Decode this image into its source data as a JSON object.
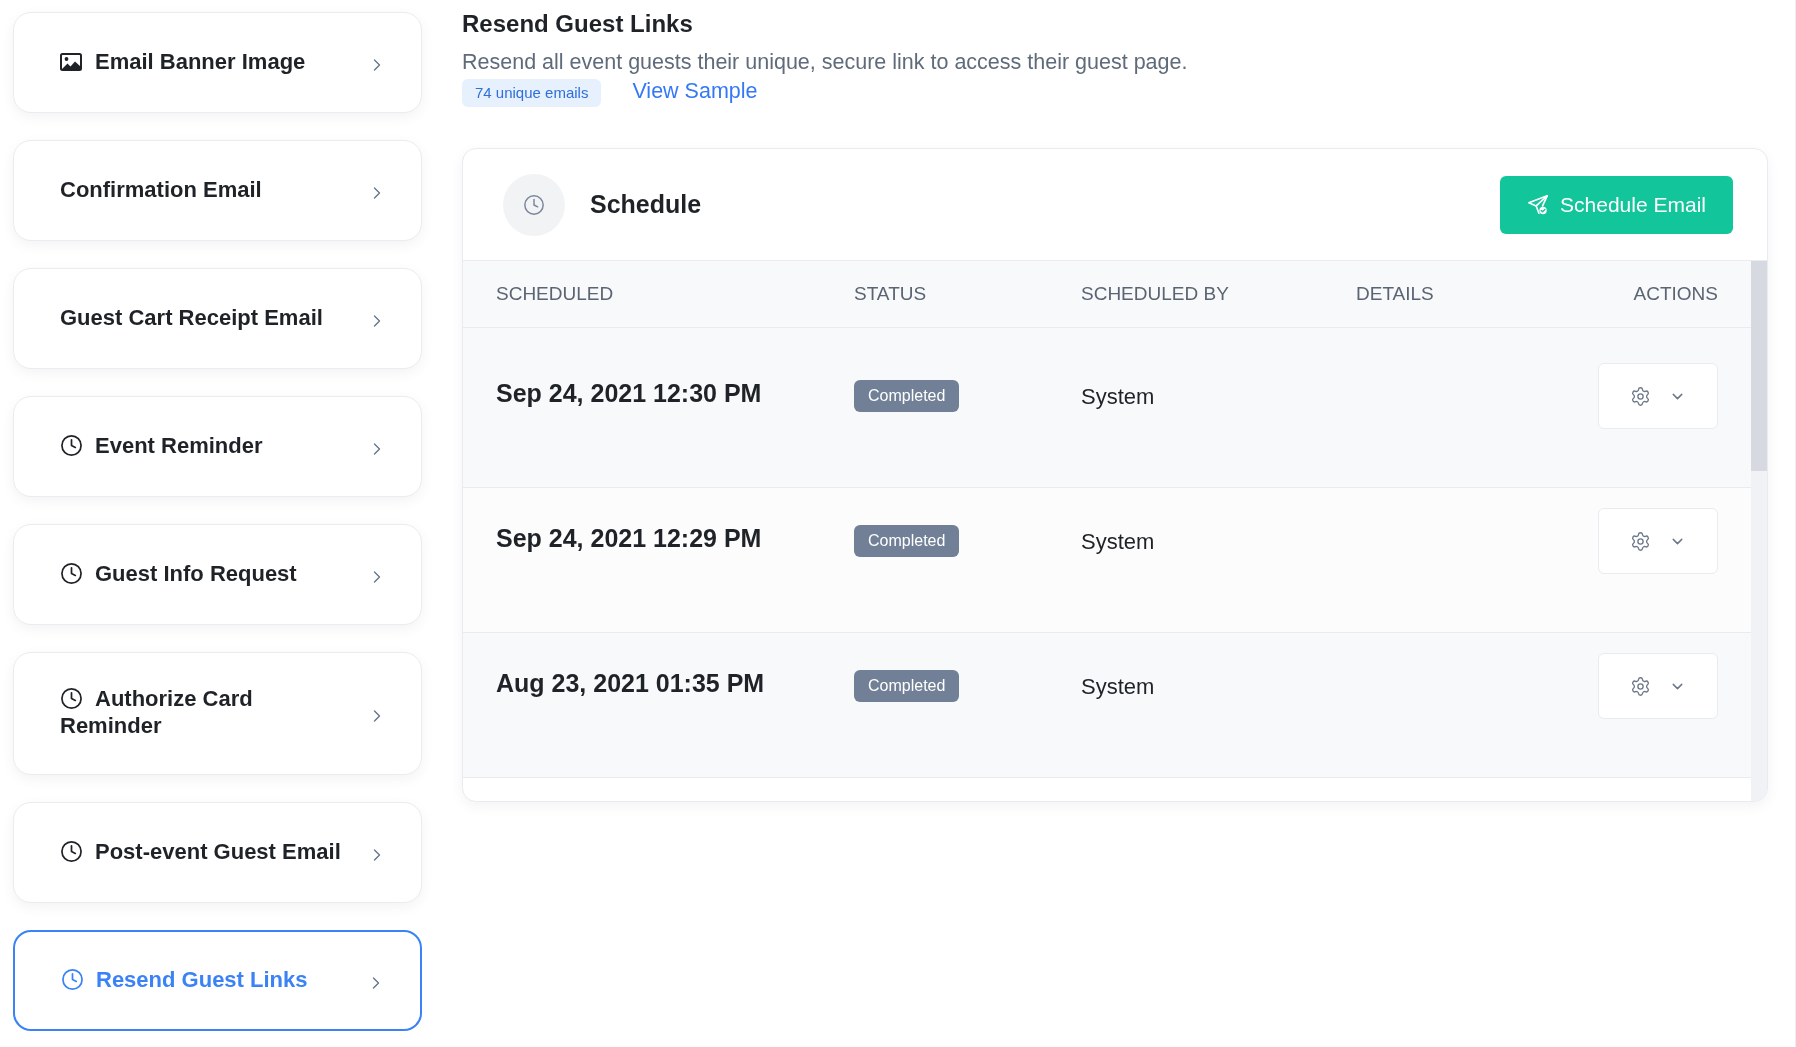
{
  "sidebar": {
    "items": [
      {
        "label": "Email Banner Image",
        "kind": "banner",
        "selected": false
      },
      {
        "label": "Confirmation Email",
        "kind": "plain",
        "selected": false
      },
      {
        "label": "Guest Cart Receipt Email",
        "kind": "plain",
        "selected": false
      },
      {
        "label": "Event Reminder",
        "kind": "scheduled",
        "selected": false
      },
      {
        "label": "Guest Info Request",
        "kind": "scheduled",
        "selected": false
      },
      {
        "label": "Authorize Card Reminder",
        "kind": "scheduled",
        "selected": false
      },
      {
        "label": "Post-event Guest Email",
        "kind": "scheduled",
        "selected": false
      },
      {
        "label": "Resend Guest Links",
        "kind": "scheduled",
        "selected": true
      }
    ]
  },
  "header": {
    "title": "Resend Guest Links",
    "description": "Resend all event guests their unique, secure link to access their guest page.",
    "badge": "74 unique emails",
    "link": "View Sample"
  },
  "schedule": {
    "title": "Schedule",
    "button": "Schedule Email",
    "table": {
      "columns": [
        "SCHEDULED",
        "STATUS",
        "SCHEDULED BY",
        "DETAILS",
        "ACTIONS"
      ],
      "rows": [
        {
          "scheduled": "Sep 24, 2021 12:30 PM",
          "status": "Completed",
          "scheduled_by": "System"
        },
        {
          "scheduled": "Sep 24, 2021 12:29 PM",
          "status": "Completed",
          "scheduled_by": "System"
        },
        {
          "scheduled": "Aug 23, 2021 01:35 PM",
          "status": "Completed",
          "scheduled_by": "System"
        }
      ]
    }
  }
}
